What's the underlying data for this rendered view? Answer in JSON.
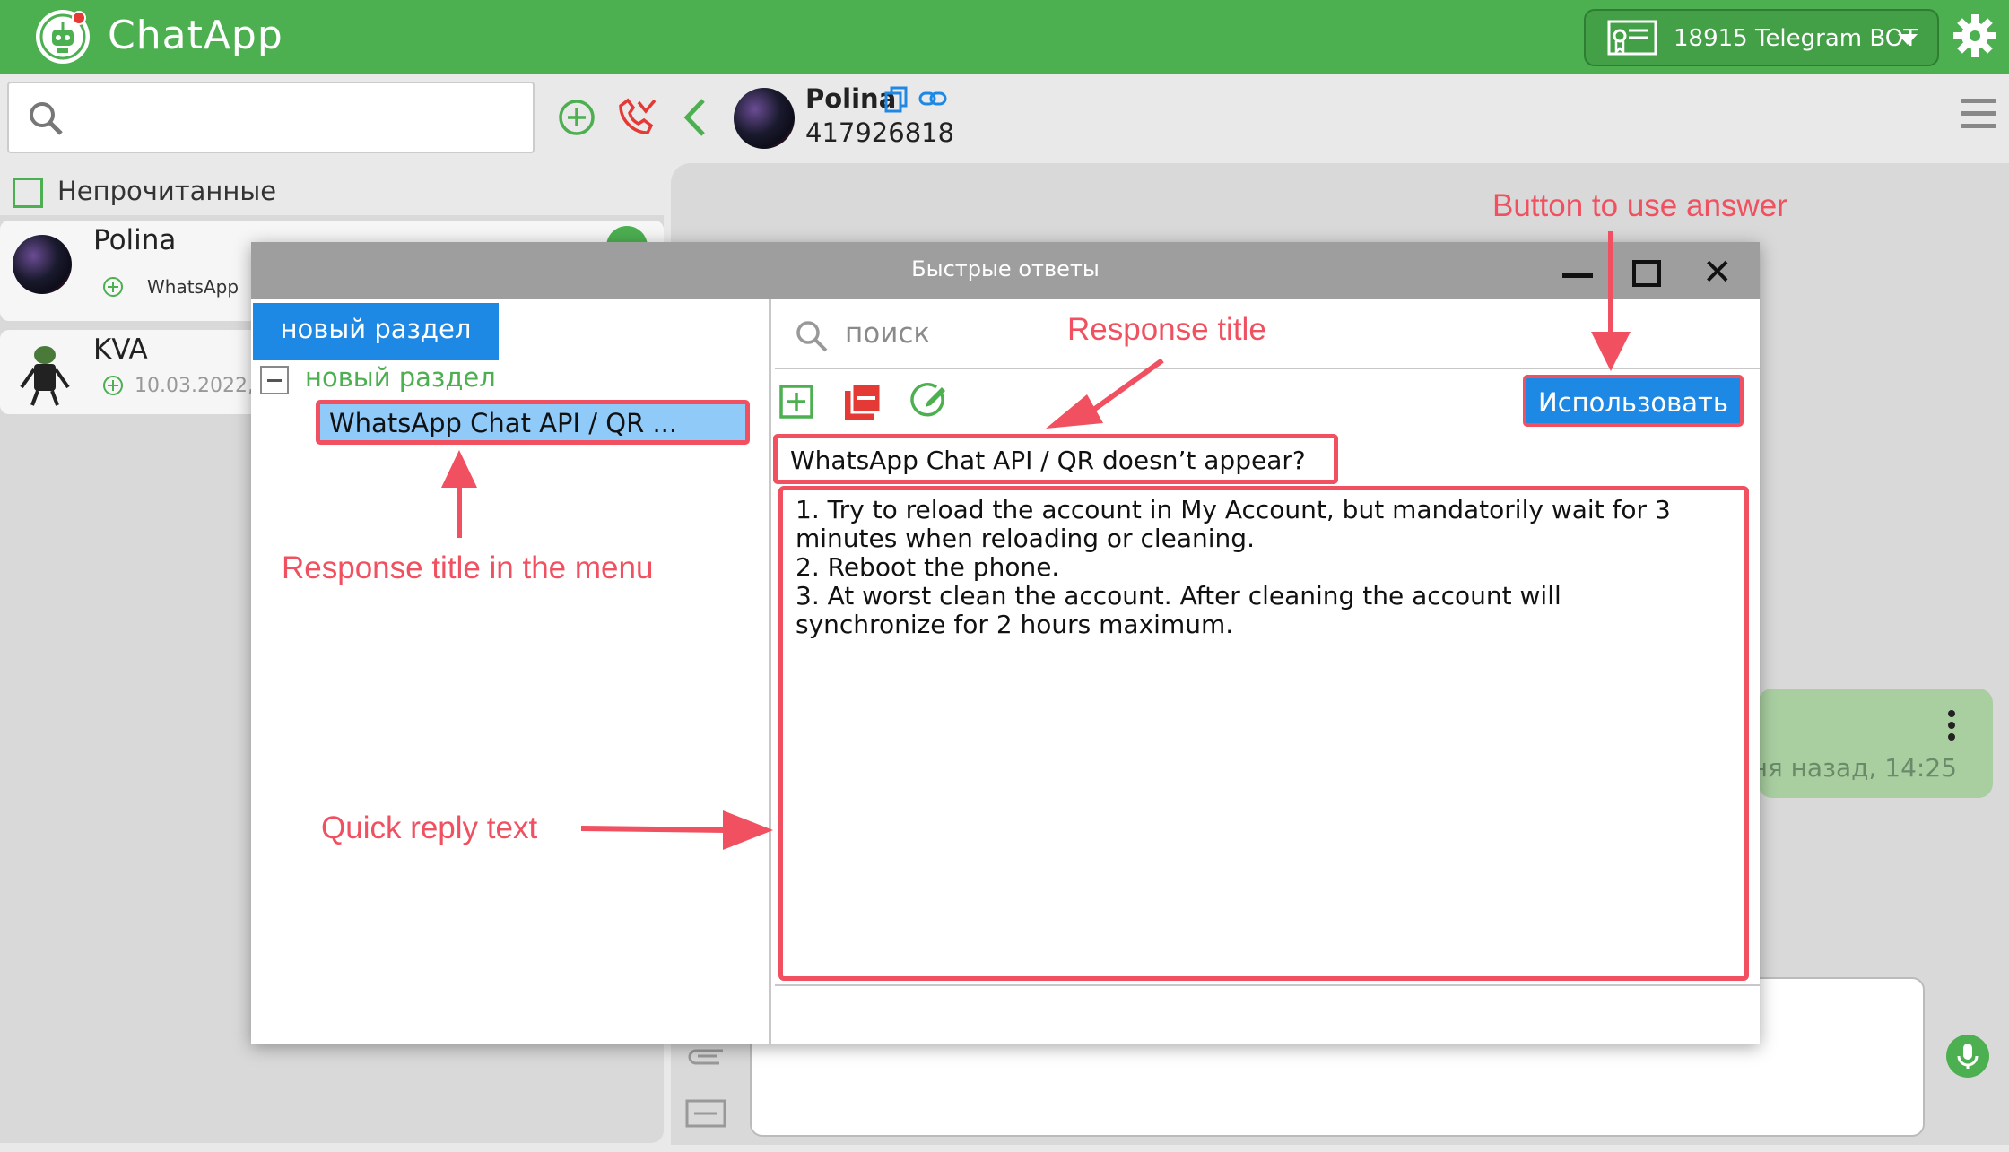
{
  "app": {
    "title": "ChatApp"
  },
  "bot_selector": {
    "label": "18915 Telegram BOT"
  },
  "sidebar": {
    "search_placeholder": "",
    "unread_label": "Непрочитанные",
    "chats": [
      {
        "name": "Polina",
        "channel": "WhatsApp"
      },
      {
        "name": "KVA",
        "date": "10.03.2022,"
      }
    ]
  },
  "chat_header": {
    "name": "Polina",
    "phone": "417926818"
  },
  "message": {
    "time": "ня назад, 14:25"
  },
  "modal": {
    "title": "Быстрые ответы",
    "section_button": "новый раздел",
    "tree_section": "новый раздел",
    "tree_item": "WhatsApp Chat API / QR ...",
    "search_placeholder": "поиск",
    "use_button": "Использовать",
    "response_title": "WhatsApp Chat API / QR doesn’t appear?",
    "response_lines": [
      "1. Try to reload the account in My Account, but mandatorily wait for 3",
      "minutes when reloading or cleaning.",
      "2. Reboot the phone.",
      "3. At worst clean the account. After cleaning the account will",
      "synchronize for 2 hours maximum."
    ]
  },
  "annotations": {
    "button_to_use": "Button to use answer",
    "response_title": "Response title",
    "response_title_menu": "Response title in the menu",
    "quick_reply_text": "Quick reply text"
  },
  "colors": {
    "brand_green": "#4caf50",
    "accent_blue": "#1e88e5",
    "annotation_red": "#f0505f"
  }
}
